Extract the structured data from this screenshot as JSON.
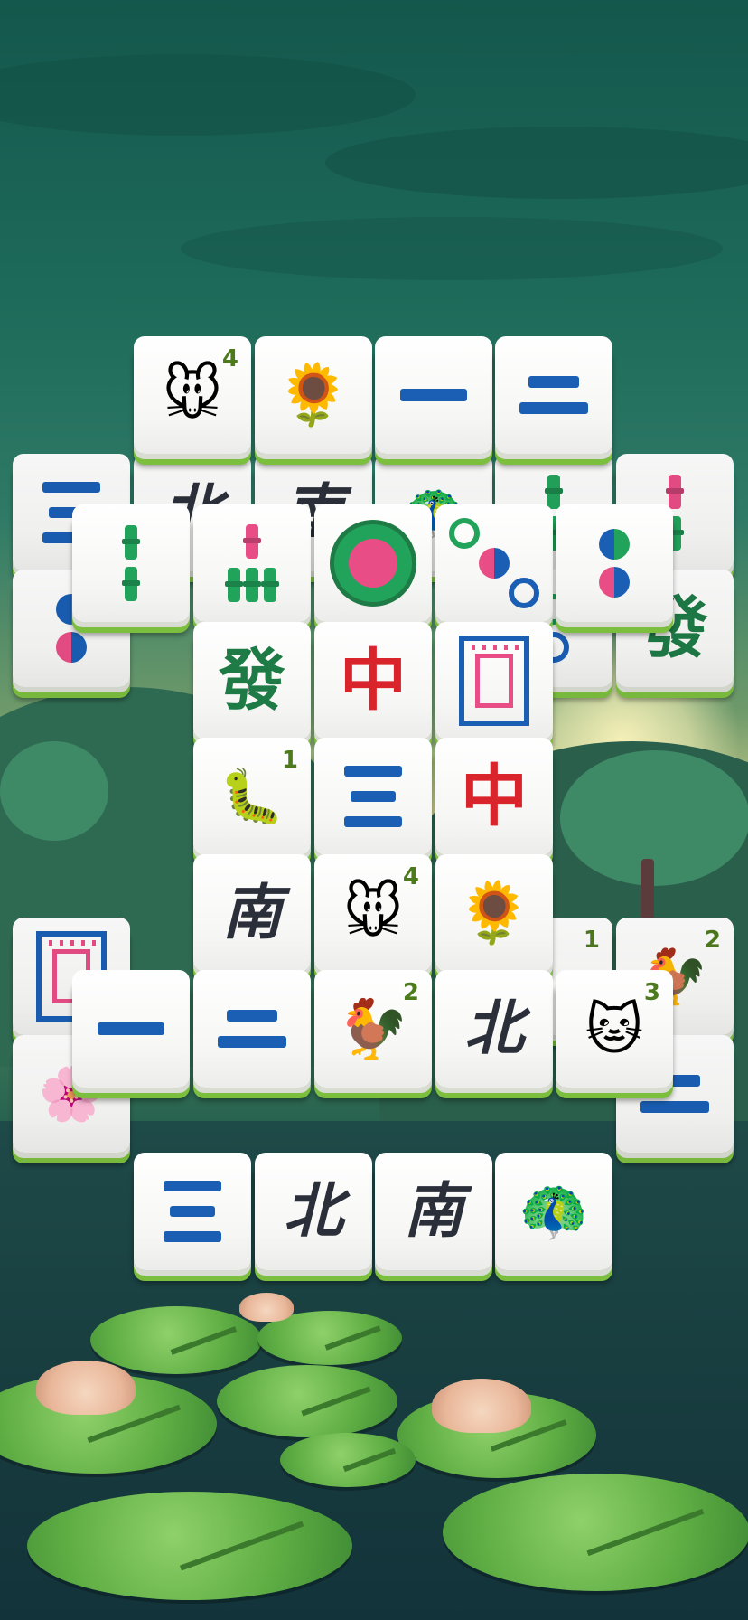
{
  "game": {
    "type": "mahjong-solitaire",
    "tiles": {
      "top_row": [
        {
          "kind": "rat",
          "number": "4"
        },
        {
          "kind": "sunflower"
        },
        {
          "kind": "character",
          "text": "一"
        },
        {
          "kind": "character",
          "text": "二"
        }
      ],
      "row2": [
        {
          "kind": "character",
          "text": "三"
        },
        {
          "kind": "wind",
          "text": "北"
        },
        {
          "kind": "wind",
          "text": "南"
        },
        {
          "kind": "peacock"
        },
        {
          "kind": "bamboo",
          "count": "2"
        },
        {
          "kind": "bamboo",
          "count": "3"
        }
      ],
      "row3_front": [
        {
          "kind": "bamboo",
          "count": "2"
        },
        {
          "kind": "bamboo",
          "count": "5"
        },
        {
          "kind": "flower-circle"
        },
        {
          "kind": "dots",
          "count": "3"
        },
        {
          "kind": "dots",
          "count": "2"
        }
      ],
      "row3_back": [
        {
          "kind": "dots",
          "count": "2"
        },
        {
          "kind": "dragon",
          "text": "發"
        }
      ],
      "center_column": [
        {
          "kind": "dragon",
          "text": "發"
        },
        {
          "kind": "dragon",
          "text": "中"
        },
        {
          "kind": "frame"
        },
        {
          "kind": "centipede",
          "number": "1"
        },
        {
          "kind": "character",
          "text": "三"
        },
        {
          "kind": "dragon",
          "text": "中"
        },
        {
          "kind": "wind",
          "text": "南"
        },
        {
          "kind": "rat",
          "number": "4"
        },
        {
          "kind": "sunflower"
        }
      ],
      "side_row": [
        {
          "kind": "frame"
        },
        {
          "kind": "number_only",
          "number": "1"
        },
        {
          "kind": "rooster",
          "number": "2"
        }
      ],
      "front_row": [
        {
          "kind": "character",
          "text": "一"
        },
        {
          "kind": "character",
          "text": "二"
        },
        {
          "kind": "rooster",
          "number": "2"
        },
        {
          "kind": "wind",
          "text": "北"
        },
        {
          "kind": "cat",
          "number": "3"
        }
      ],
      "bottom_row": [
        {
          "kind": "character",
          "text": "三"
        },
        {
          "kind": "wind",
          "text": "北"
        },
        {
          "kind": "wind",
          "text": "南"
        },
        {
          "kind": "peacock"
        }
      ]
    },
    "colors": {
      "tile_face": "#ffffff",
      "tile_edge": "#7cbf3f",
      "character_blue": "#1a5fb4",
      "dragon_red": "#d8242a",
      "dragon_green": "#1e7b46",
      "wind_dark": "#2b2f3a",
      "accent_pink": "#e94d86"
    }
  }
}
